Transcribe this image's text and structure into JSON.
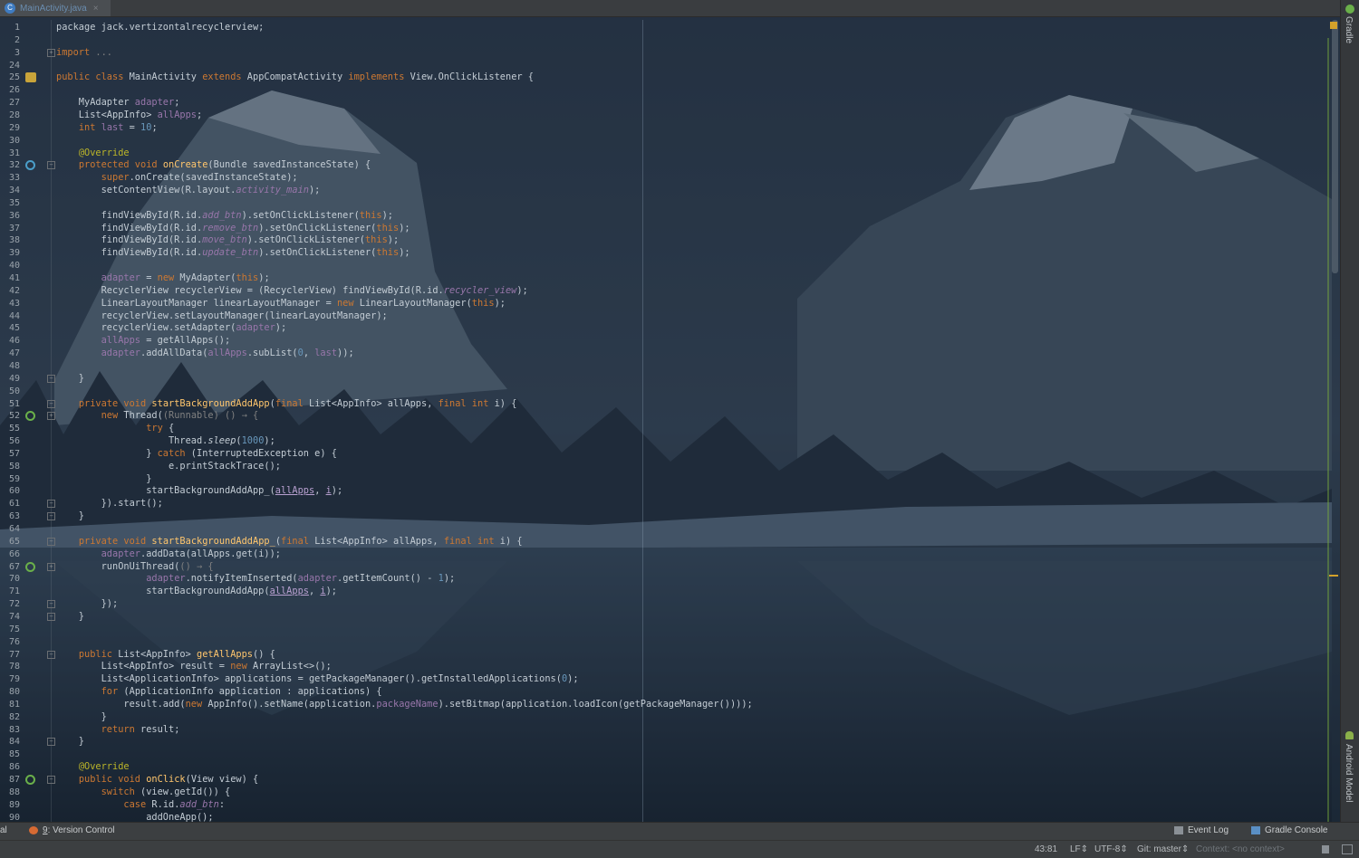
{
  "tab": {
    "title": "MainActivity.java",
    "icon": "java-class-icon",
    "close": "×"
  },
  "right_strip": {
    "gradle": "Gradle",
    "android_model": "Android Model"
  },
  "code": [
    {
      "n": "1",
      "html": "package jack.vertizontalrecyclerview;"
    },
    {
      "n": "2",
      "html": ""
    },
    {
      "n": "3",
      "html": "<span class='kw'>import</span> <span class='gray'>...</span>"
    },
    {
      "n": "24",
      "html": ""
    },
    {
      "n": "25",
      "html": "<span class='kw'>public class</span> MainActivity <span class='kw'>extends</span> AppCompatActivity <span class='kw'>implements</span> View.OnClickListener {"
    },
    {
      "n": "26",
      "html": ""
    },
    {
      "n": "27",
      "html": "    MyAdapter <span class='fld'>adapter</span>;"
    },
    {
      "n": "28",
      "html": "    List&lt;AppInfo&gt; <span class='fld'>allApps</span>;"
    },
    {
      "n": "29",
      "html": "    <span class='kw'>int</span> <span class='fld'>last</span> = <span class='num'>10</span>;"
    },
    {
      "n": "30",
      "html": ""
    },
    {
      "n": "31",
      "html": "    <span class='ann'>@Override</span>"
    },
    {
      "n": "32",
      "html": "    <span class='kw'>protected void</span> <span class='fn'>onCreate</span>(Bundle savedInstanceState) {"
    },
    {
      "n": "33",
      "html": "        <span class='kw'>super</span>.onCreate(savedInstanceState);"
    },
    {
      "n": "34",
      "html": "        setContentView(R.layout.<span class='itl'>activity_main</span>);"
    },
    {
      "n": "35",
      "html": ""
    },
    {
      "n": "36",
      "html": "        findViewById(R.id.<span class='itl'>add_btn</span>).setOnClickListener(<span class='kw'>this</span>);"
    },
    {
      "n": "37",
      "html": "        findViewById(R.id.<span class='itl'>remove_btn</span>).setOnClickListener(<span class='kw'>this</span>);"
    },
    {
      "n": "38",
      "html": "        findViewById(R.id.<span class='itl'>move_btn</span>).setOnClickListener(<span class='kw'>this</span>);"
    },
    {
      "n": "39",
      "html": "        findViewById(R.id.<span class='itl'>update_btn</span>).setOnClickListener(<span class='kw'>this</span>);"
    },
    {
      "n": "40",
      "html": ""
    },
    {
      "n": "41",
      "html": "        <span class='fld'>adapter</span> = <span class='kw'>new</span> MyAdapter(<span class='kw'>this</span>);"
    },
    {
      "n": "42",
      "html": "        RecyclerView recyclerView = (RecyclerView) findViewById(R.id.<span class='itl'>recycler_view</span>);"
    },
    {
      "n": "43",
      "html": "        LinearLayoutManager linearLayoutManager = <span class='kw'>new</span> LinearLayoutManager(<span class='kw'>this</span>);"
    },
    {
      "n": "44",
      "html": "        recyclerView.setLayoutManager(linearLayoutManager);"
    },
    {
      "n": "45",
      "html": "        recyclerView.setAdapter(<span class='fld'>adapter</span>);"
    },
    {
      "n": "46",
      "html": "        <span class='fld'>allApps</span> = getAllApps();"
    },
    {
      "n": "47",
      "html": "        <span class='fld'>adapter</span>.addAllData(<span class='fld'>allApps</span>.subList(<span class='num'>0</span>, <span class='fld'>last</span>));"
    },
    {
      "n": "48",
      "html": ""
    },
    {
      "n": "49",
      "html": "    }"
    },
    {
      "n": "50",
      "html": ""
    },
    {
      "n": "51",
      "html": "    <span class='kw'>private void</span> <span class='fn'>startBackgroundAddApp</span>(<span class='kw'>final</span> List&lt;AppInfo&gt; allApps, <span class='kw'>final int</span> i) {"
    },
    {
      "n": "52",
      "html": "        <span class='kw'>new</span> Thread(<span class='gray'>(Runnable) () → {</span>"
    },
    {
      "n": "55",
      "html": "                <span class='kw'>try</span> {"
    },
    {
      "n": "56",
      "html": "                    Thread.<span class='itl' style='color:#c3ccd4'>sleep</span>(<span class='num'>1000</span>);"
    },
    {
      "n": "57",
      "html": "                } <span class='kw'>catch</span> (InterruptedException e) {"
    },
    {
      "n": "58",
      "html": "                    e.printStackTrace();"
    },
    {
      "n": "59",
      "html": "                }"
    },
    {
      "n": "60",
      "html": "                startBackgroundAddApp_(<span class='und'>allApps</span>, <span class='und'>i</span>);"
    },
    {
      "n": "61",
      "html": "        }).start();"
    },
    {
      "n": "63",
      "html": "    }"
    },
    {
      "n": "64",
      "html": ""
    },
    {
      "n": "65",
      "html": "    <span class='kw'>private void</span> <span class='fn'>startBackgroundAddApp_</span>(<span class='kw'>final</span> List&lt;AppInfo&gt; allApps, <span class='kw'>final int</span> i) {"
    },
    {
      "n": "66",
      "html": "        <span class='fld'>adapter</span>.addData(allApps.get(i));"
    },
    {
      "n": "67",
      "html": "        runOnUiThread(<span class='gray'>() → {</span>"
    },
    {
      "n": "70",
      "html": "                <span class='fld'>adapter</span>.notifyItemInserted(<span class='fld'>adapter</span>.getItemCount() - <span class='num'>1</span>);"
    },
    {
      "n": "71",
      "html": "                startBackgroundAddApp(<span class='und'>allApps</span>, <span class='und'>i</span>);"
    },
    {
      "n": "72",
      "html": "        });"
    },
    {
      "n": "74",
      "html": "    }"
    },
    {
      "n": "75",
      "html": ""
    },
    {
      "n": "76",
      "html": ""
    },
    {
      "n": "77",
      "html": "    <span class='kw'>public</span> List&lt;AppInfo&gt; <span class='fn'>getAllApps</span>() {"
    },
    {
      "n": "78",
      "html": "        List&lt;AppInfo&gt; result = <span class='kw'>new</span> ArrayList&lt;&gt;();"
    },
    {
      "n": "79",
      "html": "        List&lt;ApplicationInfo&gt; applications = getPackageManager().getInstalledApplications(<span class='num'>0</span>);"
    },
    {
      "n": "80",
      "html": "        <span class='kw'>for</span> (ApplicationInfo application : applications) {"
    },
    {
      "n": "81",
      "html": "            result.add(<span class='kw'>new</span> AppInfo().setName(application.<span class='fld'>packageName</span>).setBitmap(application.loadIcon(getPackageManager())));"
    },
    {
      "n": "82",
      "html": "        }"
    },
    {
      "n": "83",
      "html": "        <span class='kw'>return</span> result;"
    },
    {
      "n": "84",
      "html": "    }"
    },
    {
      "n": "85",
      "html": ""
    },
    {
      "n": "86",
      "html": "    <span class='ann'>@Override</span>"
    },
    {
      "n": "87",
      "html": "    <span class='kw'>public void</span> <span class='fn'>onClick</span>(View view) {"
    },
    {
      "n": "88",
      "html": "        <span class='kw'>switch</span> (view.getId()) {"
    },
    {
      "n": "89",
      "html": "            <span class='kw'>case</span> R.id.<span class='itl'>add_btn</span>:"
    },
    {
      "n": "90",
      "html": "                addOneApp();"
    }
  ],
  "toolbar": {
    "left_partial": "al",
    "version_control_num": "9",
    "version_control_label": ": Version Control",
    "event_log": "Event Log",
    "gradle_console": "Gradle Console"
  },
  "status": {
    "position": "43:81",
    "line_sep": "LF⇕",
    "encoding": "UTF-8⇕",
    "git": "Git: master⇕",
    "context": "Context: <no context>"
  },
  "colors": {
    "keyword": "#cc7832",
    "function": "#ffc66d",
    "number": "#6897bb",
    "annotation": "#bbb529",
    "field": "#9876aa"
  }
}
